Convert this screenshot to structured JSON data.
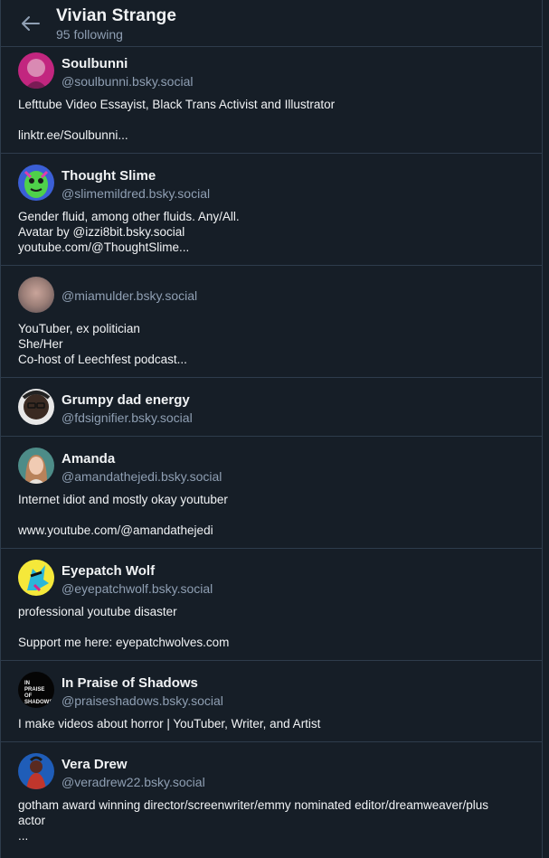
{
  "header": {
    "title": "Vivian Strange",
    "subtitle": "95 following",
    "back_icon": "arrow-left-icon"
  },
  "colors": {
    "background": "#161e27",
    "divider": "#2e3c4c",
    "text_primary": "#f1f3f5",
    "text_secondary": "#8f9fb3"
  },
  "follows": [
    {
      "name": "Soulbunni",
      "handle": "@soulbunni.bsky.social",
      "bio": "Lefttube Video Essayist, Black Trans Activist and Illustrator\n\nlinktr.ee/Soulbunni..."
    },
    {
      "name": "Thought Slime",
      "handle": "@slimemildred.bsky.social",
      "bio": "Gender fluid, among other fluids. Any/All.\nAvatar by @izzi8bit.bsky.social\nyoutube.com/@ThoughtSlime..."
    },
    {
      "name": "",
      "handle": "@miamulder.bsky.social",
      "bio": "YouTuber, ex politician\nShe/Her\nCo-host of Leechfest podcast..."
    },
    {
      "name": "Grumpy dad energy",
      "handle": "@fdsignifier.bsky.social",
      "bio": ""
    },
    {
      "name": "Amanda",
      "handle": "@amandathejedi.bsky.social",
      "bio": "Internet idiot and mostly okay youtuber\n\nwww.youtube.com/@amandathejedi"
    },
    {
      "name": "Eyepatch Wolf",
      "handle": "@eyepatchwolf.bsky.social",
      "bio": "professional youtube disaster\n\nSupport me here: eyepatchwolves.com"
    },
    {
      "name": "In Praise of Shadows",
      "handle": "@praiseshadows.bsky.social",
      "bio": "I make videos about horror | YouTuber, Writer, and Artist",
      "avatar_text": "IN PRAISE OF SHADOWS"
    },
    {
      "name": "Vera Drew",
      "handle": "@veradrew22.bsky.social",
      "bio": "gotham award winning director/screenwriter/emmy nominated editor/dreamweaver/plus actor\n..."
    }
  ]
}
